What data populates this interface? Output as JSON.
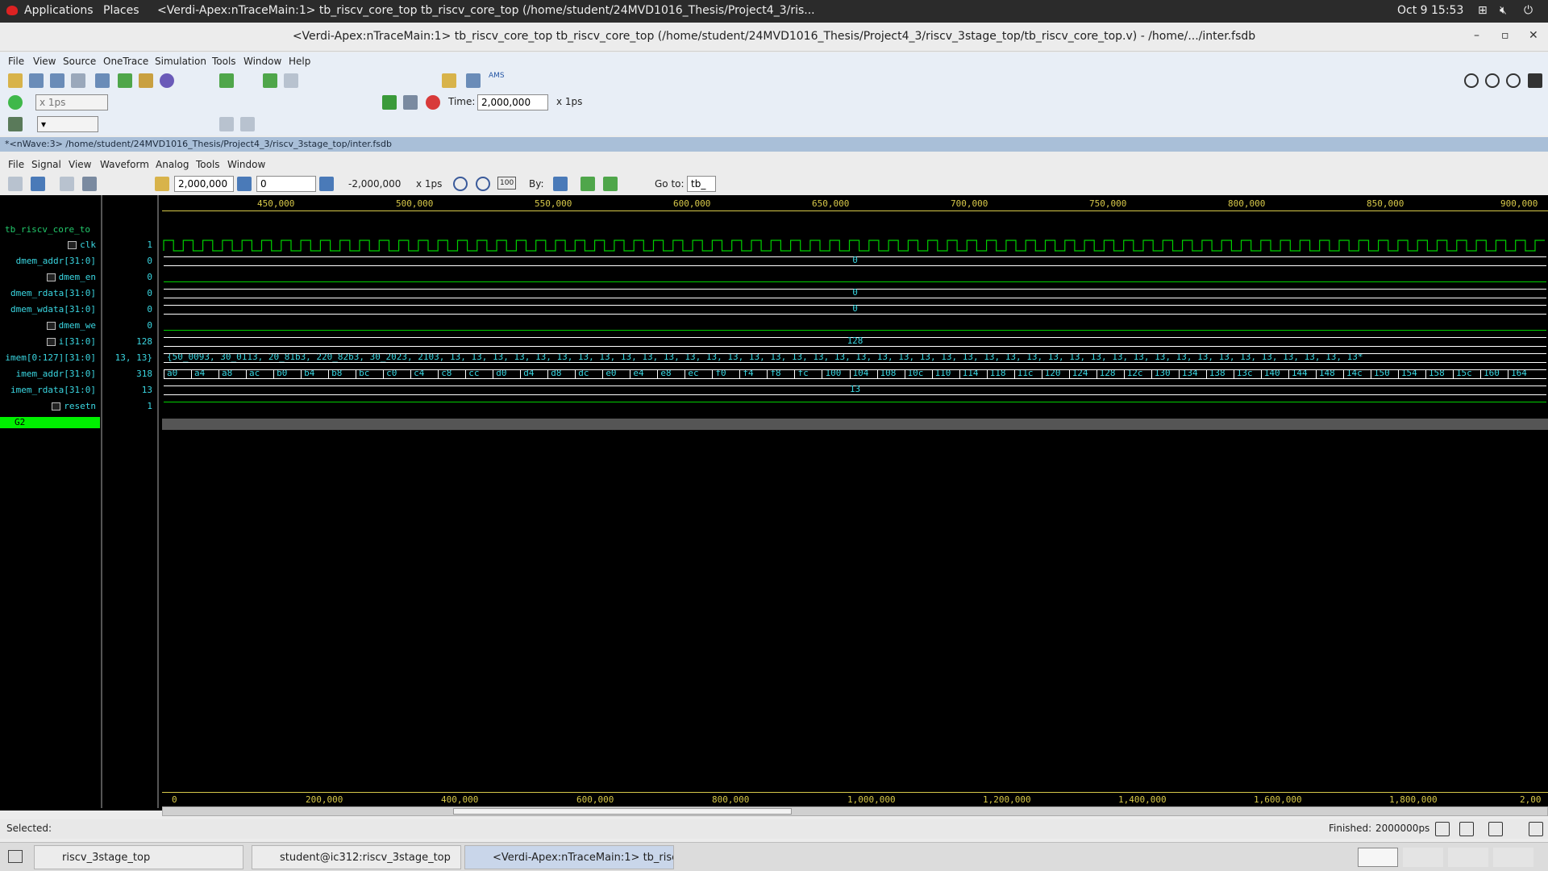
{
  "topbar": {
    "apps": "Applications",
    "places": "Places",
    "window_title": "<Verdi-Apex:nTraceMain:1> tb_riscv_core_top tb_riscv_core_top (/home/student/24MVD1016_Thesis/Project4_3/ris...",
    "datetime": "Oct 9  15:53"
  },
  "titlebar": {
    "title": "<Verdi-Apex:nTraceMain:1> tb_riscv_core_top tb_riscv_core_top (/home/student/24MVD1016_Thesis/Project4_3/riscv_3stage_top/tb_riscv_core_top.v) - /home/.../inter.fsdb"
  },
  "main_menu": [
    "File",
    "View",
    "Source",
    "OneTrace",
    "Simulation",
    "Tools",
    "Window",
    "Help"
  ],
  "toolbar": {
    "run_unit": "x 1ps",
    "time_label": "Time:",
    "time_value": "2,000,000",
    "time_unit": "x 1ps",
    "ams": "AMS"
  },
  "nwave": {
    "title": "*<nWave:3> /home/student/24MVD1016_Thesis/Project4_3/riscv_3stage_top/inter.fsdb"
  },
  "wave_menu": [
    "File",
    "Signal",
    "View",
    "Waveform",
    "Analog",
    "Tools",
    "Window"
  ],
  "wave_toolbar": {
    "cursor": "2,000,000",
    "marker": "0",
    "delta": "-2,000,000",
    "unit": "x 1ps",
    "by_label": "By:",
    "goto_label": "Go to:",
    "goto_value": "tb_",
    "zoom_100": "100"
  },
  "signals": {
    "scope": "tb_riscv_core_to",
    "items": [
      {
        "name": "clk",
        "value": "1"
      },
      {
        "name": "dmem_addr[31:0]",
        "value": "0"
      },
      {
        "name": "dmem_en",
        "value": "0"
      },
      {
        "name": "dmem_rdata[31:0]",
        "value": "0"
      },
      {
        "name": "dmem_wdata[31:0]",
        "value": "0"
      },
      {
        "name": "dmem_we",
        "value": "0"
      },
      {
        "name": "i[31:0]",
        "value": "128"
      },
      {
        "name": "imem[0:127][31:0]",
        "value": "13, 13}"
      },
      {
        "name": "imem_addr[31:0]",
        "value": "318"
      },
      {
        "name": "imem_rdata[31:0]",
        "value": "13"
      },
      {
        "name": "resetn",
        "value": "1"
      }
    ],
    "group": "G2"
  },
  "waves": {
    "dmem_addr": "0",
    "dmem_rdata": "0",
    "dmem_wdata": "0",
    "i": "128",
    "imem": "{50_0093, 30_0113, 20_81b3, 220_82b3, 30_2023, 2103, 13, 13, 13, 13, 13, 13, 13, 13, 13, 13, 13, 13, 13, 13, 13, 13, 13, 13, 13, 13, 13, 13, 13, 13, 13, 13, 13, 13, 13, 13, 13, 13, 13, 13, 13, 13, 13, 13, 13, 13, 13, 13, 13*",
    "imem_addr": [
      "a0",
      "a4",
      "a8",
      "ac",
      "b0",
      "b4",
      "b8",
      "bc",
      "c0",
      "c4",
      "c8",
      "cc",
      "d0",
      "d4",
      "d8",
      "dc",
      "e0",
      "e4",
      "e8",
      "ec",
      "f0",
      "f4",
      "f8",
      "fc",
      "100",
      "104",
      "108",
      "10c",
      "110",
      "114",
      "118",
      "11c",
      "120",
      "124",
      "128",
      "12c",
      "130",
      "134",
      "138",
      "13c",
      "140",
      "144",
      "148",
      "14c",
      "150",
      "154",
      "158",
      "15c",
      "160",
      "164"
    ],
    "imem_rdata": "13"
  },
  "ruler_top": [
    "450,000",
    "500,000",
    "550,000",
    "600,000",
    "650,000",
    "700,000",
    "750,000",
    "800,000",
    "850,000",
    "900,000"
  ],
  "ruler_bottom": [
    "0",
    "200,000",
    "400,000",
    "600,000",
    "800,000",
    "1,000,000",
    "1,200,000",
    "1,400,000",
    "1,600,000",
    "1,800,000",
    "2,00"
  ],
  "status": {
    "selected": "Selected:",
    "finished_label": "Finished:",
    "finished_value": "2000000ps"
  },
  "taskbar": [
    "riscv_3stage_top",
    "student@ic312:riscv_3stage_top",
    "<Verdi-Apex:nTraceMain:1> tb_riscv..."
  ]
}
